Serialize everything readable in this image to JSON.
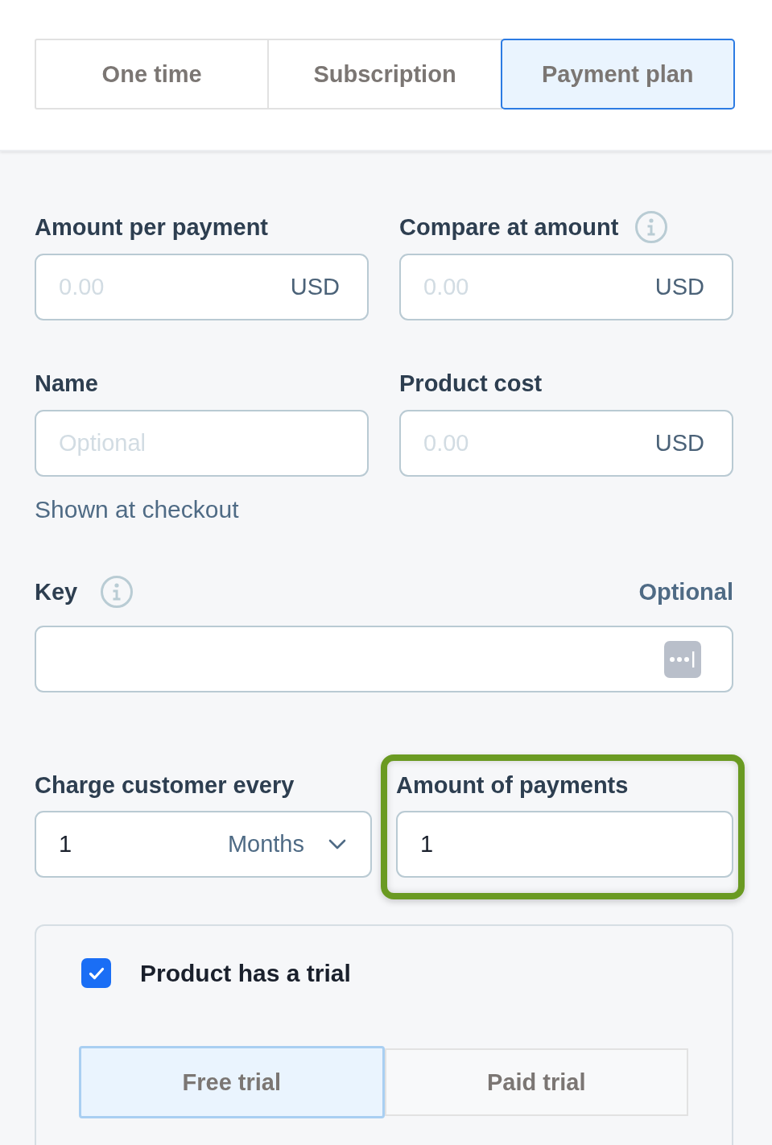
{
  "tabs": [
    {
      "label": "One time",
      "selected": false
    },
    {
      "label": "Subscription",
      "selected": false
    },
    {
      "label": "Payment plan",
      "selected": true
    }
  ],
  "fields": [
    {
      "kind": "currency",
      "label": "Amount per payment",
      "info": false,
      "placeholder": "0.00",
      "suffix": "USD"
    },
    {
      "kind": "currency",
      "label": "Compare at amount",
      "info": true,
      "placeholder": "0.00",
      "suffix": "USD"
    },
    {
      "kind": "text",
      "label": "Name",
      "info": false,
      "placeholder": "Optional",
      "hint": "Shown at checkout"
    },
    {
      "kind": "currency",
      "label": "Product cost",
      "info": false,
      "placeholder": "0.00",
      "suffix": "USD"
    }
  ],
  "key_field": {
    "label": "Key",
    "info": true,
    "note": "Optional"
  },
  "charge_every": {
    "label": "Charge customer every",
    "value": "1",
    "unit": "Months"
  },
  "payments_count": {
    "label": "Amount of payments",
    "value": "1",
    "highlighted": true
  },
  "trial": {
    "label": "Product has a trial",
    "checked": true,
    "options": [
      {
        "label": "Free trial",
        "selected": true
      },
      {
        "label": "Paid trial",
        "selected": false
      }
    ]
  }
}
